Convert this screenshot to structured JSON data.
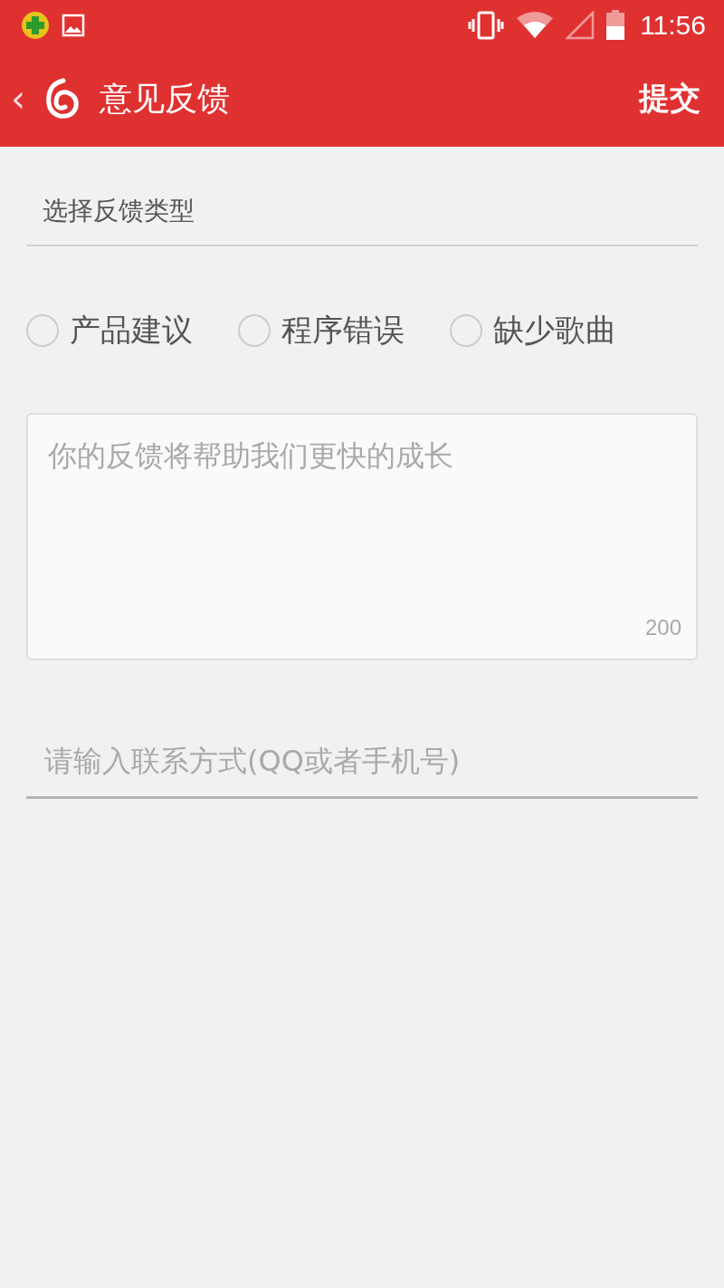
{
  "status_bar": {
    "time": "11:56"
  },
  "app_bar": {
    "back": "‹",
    "title": "意见反馈",
    "action": "提交"
  },
  "feedback_type": {
    "label": "选择反馈类型",
    "options": [
      {
        "label": "产品建议",
        "selected": false
      },
      {
        "label": "程序错误",
        "selected": false
      },
      {
        "label": "缺少歌曲",
        "selected": false
      }
    ]
  },
  "feedback": {
    "placeholder": "你的反馈将帮助我们更快的成长",
    "counter": "200"
  },
  "contact": {
    "placeholder": "请输入联系方式(QQ或者手机号)"
  }
}
